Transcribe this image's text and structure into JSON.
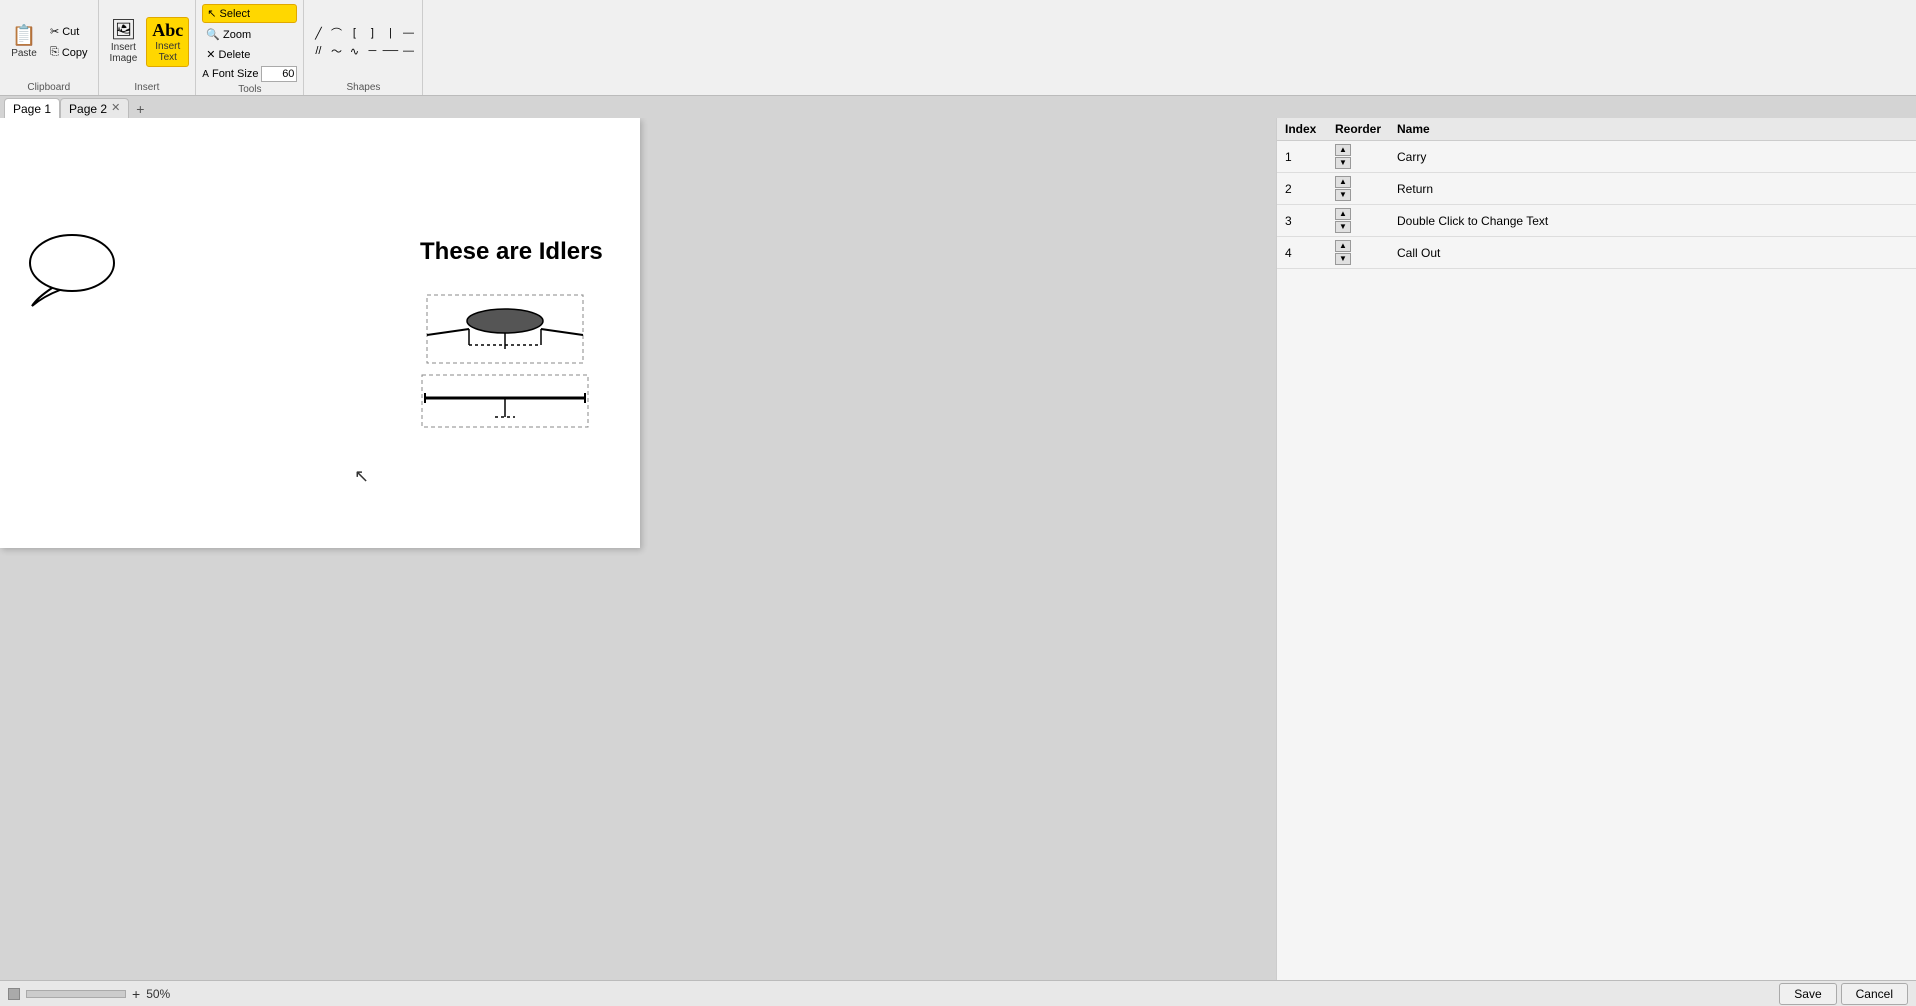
{
  "toolbar": {
    "clipboard": {
      "label": "Clipboard",
      "paste_label": "Paste",
      "cut_label": "Cut",
      "copy_label": "Copy"
    },
    "insert": {
      "label": "Insert",
      "insert_image_label": "Insert\nImage",
      "insert_text_label": "Insert\nText"
    },
    "tools": {
      "label": "Tools",
      "select_label": "Select",
      "zoom_label": "Zoom",
      "delete_label": "Delete",
      "font_size_label": "Font Size",
      "font_size_value": "60"
    },
    "shapes": {
      "label": "Shapes"
    }
  },
  "tabs": [
    {
      "id": "page1",
      "label": "Page 1",
      "active": true,
      "closeable": false
    },
    {
      "id": "page2",
      "label": "Page 2",
      "active": false,
      "closeable": true
    }
  ],
  "canvas": {
    "title_text": "These are Idlers"
  },
  "right_panel": {
    "columns": {
      "index": "Index",
      "reorder": "Reorder",
      "name": "Name"
    },
    "rows": [
      {
        "index": "1",
        "name": "Carry"
      },
      {
        "index": "2",
        "name": "Return"
      },
      {
        "index": "3",
        "name": "Double Click to Change Text"
      },
      {
        "index": "4",
        "name": "Call Out"
      }
    ]
  },
  "bottom_bar": {
    "zoom_value": "50%",
    "save_label": "Save",
    "cancel_label": "Cancel"
  }
}
